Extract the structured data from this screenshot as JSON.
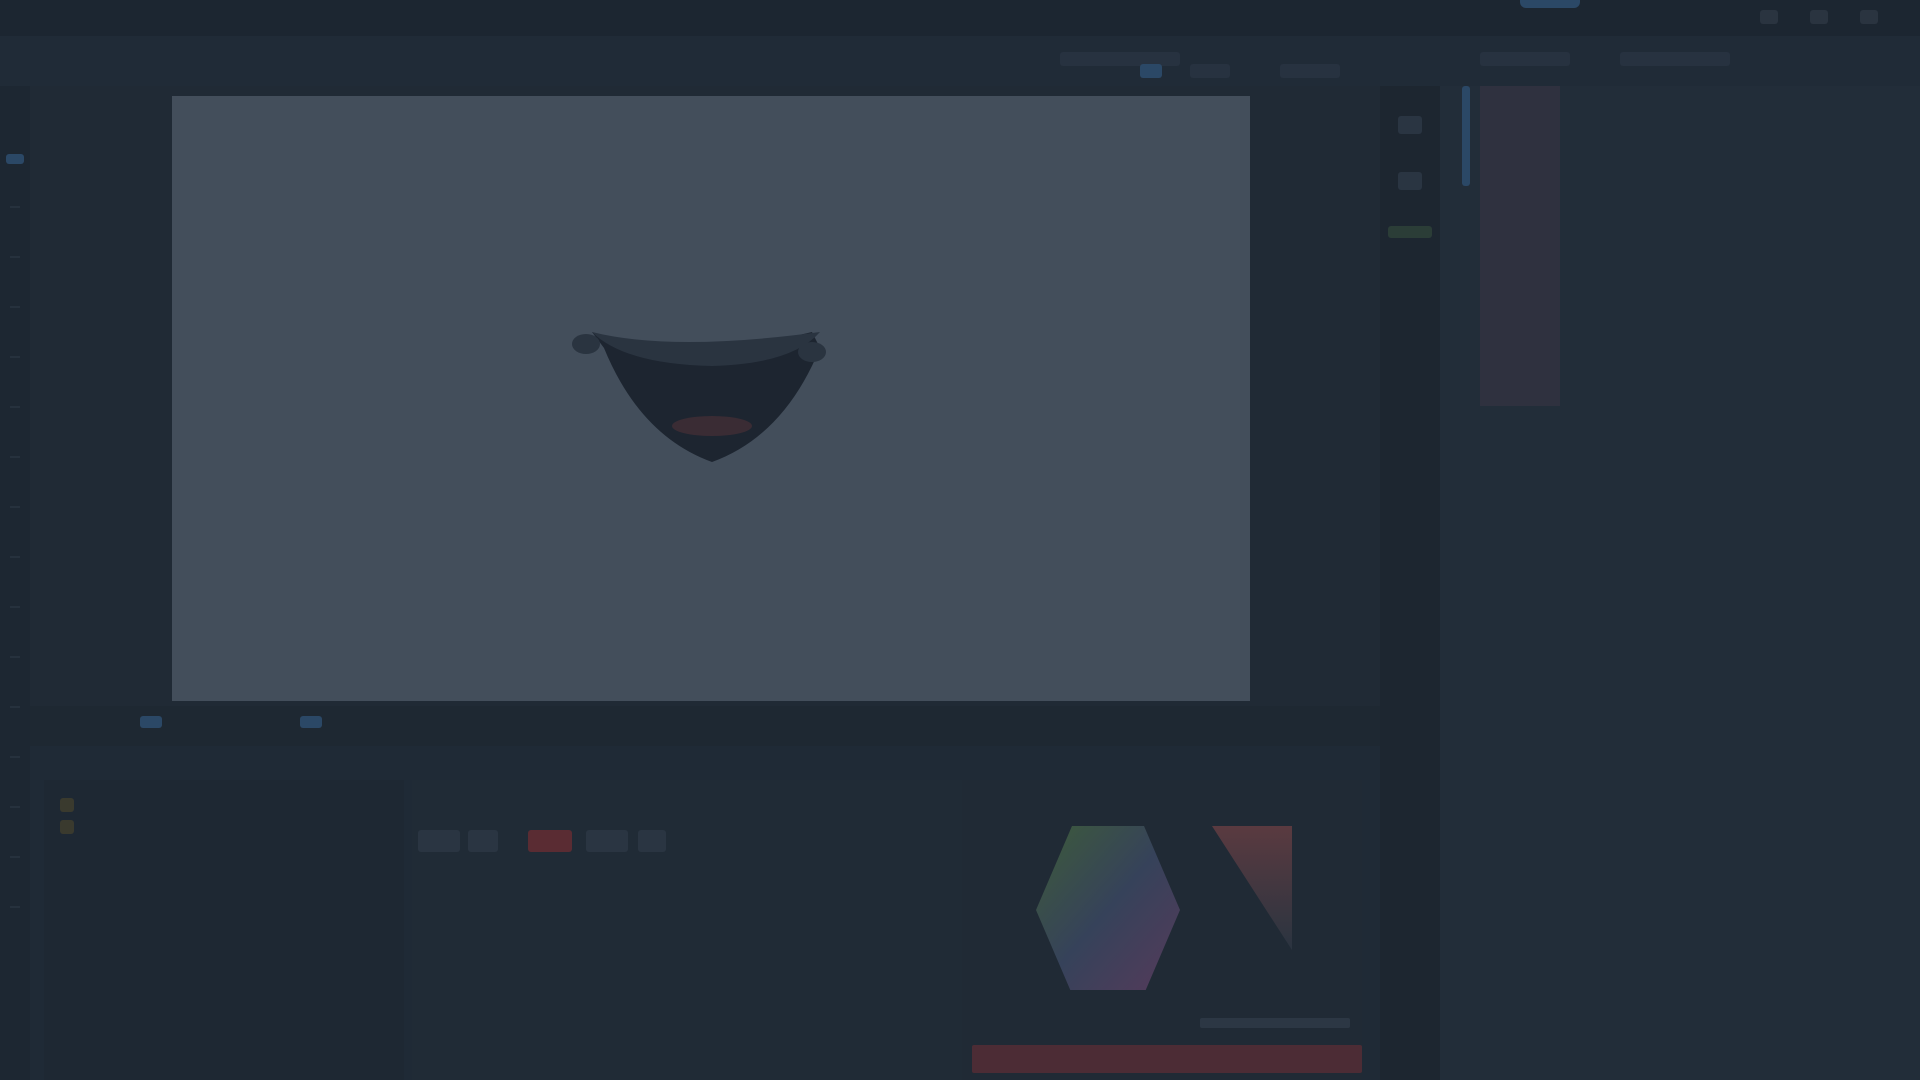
{
  "app": {
    "menu_items": [
      "",
      "",
      "",
      "",
      "",
      "",
      "",
      "",
      "",
      "",
      ""
    ],
    "accent": "#2b4866",
    "window_controls": [
      "minimize-icon",
      "maximize-icon",
      "close-icon"
    ]
  },
  "toolbar": {
    "chips": 6
  },
  "tools": {
    "selected": "select-tool-icon"
  },
  "canvas": {
    "background": "#434e5b",
    "artwork": "mouth-drawing"
  },
  "timeline": {
    "marks": 2
  },
  "assets_panel": {
    "items": [
      "",
      ""
    ],
    "footer": ""
  },
  "props_panel": {
    "buttons": [
      "",
      "",
      "",
      "",
      ""
    ],
    "stroke_color": "#c23a47"
  },
  "color_panel": {
    "hex_value": "",
    "current_color": "#c23a47"
  },
  "layers_panel": {
    "rows": 3
  }
}
